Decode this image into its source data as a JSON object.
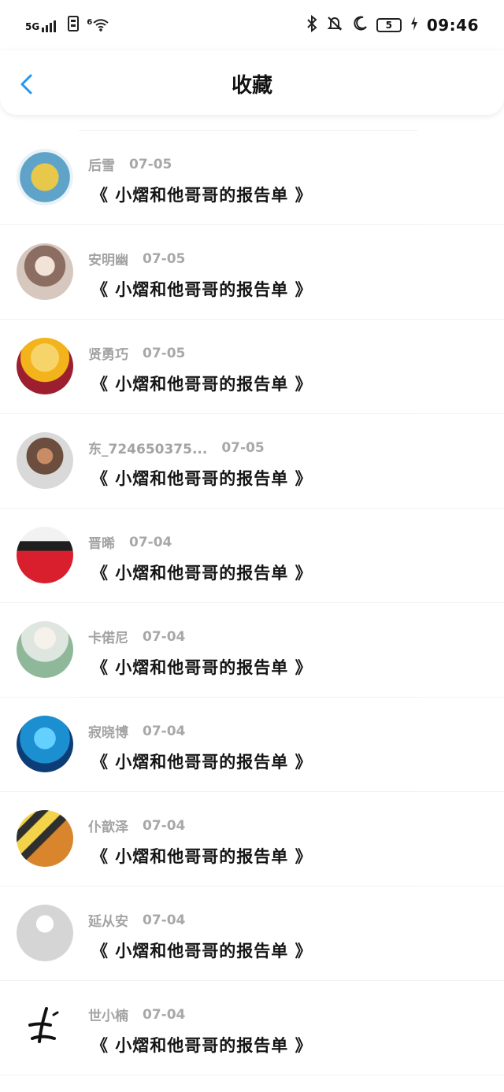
{
  "status_bar": {
    "signal": "5G",
    "wifi": "6",
    "battery": "5",
    "time": "09:46",
    "icons": [
      "signal-icon",
      "sim-icon",
      "wifi-icon",
      "bluetooth-icon",
      "mute-icon",
      "moon-icon",
      "battery-icon",
      "charging-icon"
    ]
  },
  "header": {
    "title": "收藏",
    "back_icon": "chevron-left-icon"
  },
  "items": [
    {
      "name": "后雪",
      "date": "07-05",
      "subject": "《 小熠和他哥哥的报告单 》",
      "avatar_colors": [
        "#5fa4c8",
        "#e7c84b"
      ]
    },
    {
      "name": "安明幽",
      "date": "07-05",
      "subject": "《 小熠和他哥哥的报告单 》",
      "avatar_colors": [
        "#d6c7bf",
        "#8b6d61"
      ]
    },
    {
      "name": "贤勇巧",
      "date": "07-05",
      "subject": "《 小熠和他哥哥的报告单 》",
      "avatar_colors": [
        "#f2b31b",
        "#9c1f2f"
      ]
    },
    {
      "name": "东_724650375...",
      "date": "07-05",
      "subject": "《 小熠和他哥哥的报告单 》",
      "avatar_colors": [
        "#d9d9d9",
        "#6b4e3e"
      ]
    },
    {
      "name": "晋晞",
      "date": "07-04",
      "subject": "《 小熠和他哥哥的报告单 》",
      "avatar_colors": [
        "#d91f2d",
        "#f0f0f0"
      ]
    },
    {
      "name": "卡偌尼",
      "date": "07-04",
      "subject": "《 小熠和他哥哥的报告单 》",
      "avatar_colors": [
        "#f3f3f3",
        "#8fb89b"
      ]
    },
    {
      "name": "寂晓博",
      "date": "07-04",
      "subject": "《 小熠和他哥哥的报告单 》",
      "avatar_colors": [
        "#1c8fd1",
        "#0d3d77"
      ]
    },
    {
      "name": "仆歆泽",
      "date": "07-04",
      "subject": "《 小熠和他哥哥的报告单 》",
      "avatar_colors": [
        "#d8852d",
        "#2f2f2f"
      ]
    },
    {
      "name": "延从安",
      "date": "07-04",
      "subject": "《 小熠和他哥哥的报告单 》",
      "avatar_colors": [
        "#eeeeee",
        "#d5d5d5"
      ]
    },
    {
      "name": "世小楠",
      "date": "07-04",
      "subject": "《 小熠和他哥哥的报告单 》",
      "avatar_colors": [
        "#ffffff",
        "#111111"
      ]
    }
  ]
}
